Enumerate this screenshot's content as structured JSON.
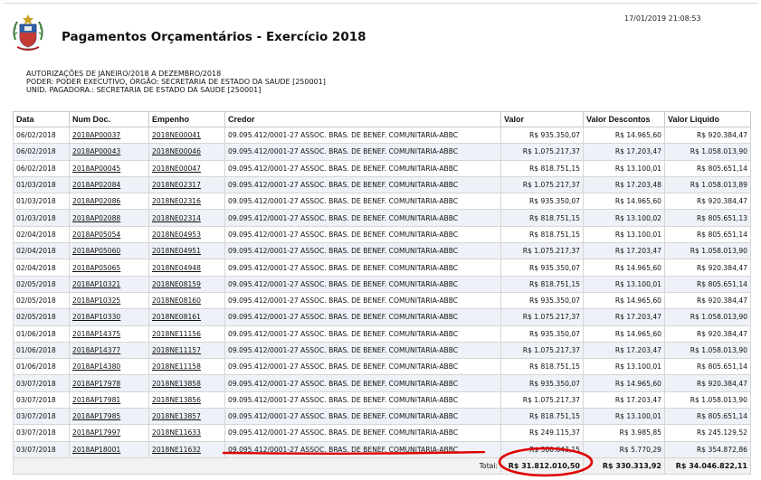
{
  "header": {
    "timestamp": "17/01/2019 21:08:53",
    "title": "Pagamentos Orçamentários - Exercício 2018",
    "crest_icon": "coat-of-arms-icon"
  },
  "info": {
    "line1": "AUTORIZAÇÕES DE JANEIRO/2018 A DEZEMBRO/2018",
    "line2": "PODER: PODER EXECUTIVO, ÓRGÃO: SECRETARIA DE ESTADO DA SAUDE [250001]",
    "line3": "UNID. PAGADORA.: SECRETARIA DE ESTADO DA SAUDE [250001]"
  },
  "table": {
    "columns": [
      "Data",
      "Num Doc.",
      "Empenho",
      "Credor",
      "Valor",
      "Valor Descontos",
      "Valor Liquido"
    ],
    "rows": [
      [
        "06/02/2018",
        "2018AP00037",
        "2018NE00041",
        "09.095.412/0001-27 ASSOC. BRAS. DE BENEF. COMUNITARIA-ABBC",
        "R$ 935.350,07",
        "R$ 14.965,60",
        "R$ 920.384,47"
      ],
      [
        "06/02/2018",
        "2018AP00043",
        "2018NE00046",
        "09.095.412/0001-27 ASSOC. BRAS. DE BENEF. COMUNITARIA-ABBC",
        "R$ 1.075.217,37",
        "R$ 17.203,47",
        "R$ 1.058.013,90"
      ],
      [
        "06/02/2018",
        "2018AP00045",
        "2018NE00047",
        "09.095.412/0001-27 ASSOC. BRAS. DE BENEF. COMUNITARIA-ABBC",
        "R$ 818.751,15",
        "R$ 13.100,01",
        "R$ 805.651,14"
      ],
      [
        "01/03/2018",
        "2018AP02084",
        "2018NE02317",
        "09.095.412/0001-27 ASSOC. BRAS. DE BENEF. COMUNITARIA-ABBC",
        "R$ 1.075.217,37",
        "R$ 17.203,48",
        "R$ 1.058.013,89"
      ],
      [
        "01/03/2018",
        "2018AP02086",
        "2018NE02316",
        "09.095.412/0001-27 ASSOC. BRAS. DE BENEF. COMUNITARIA-ABBC",
        "R$ 935.350,07",
        "R$ 14.965,60",
        "R$ 920.384,47"
      ],
      [
        "01/03/2018",
        "2018AP02088",
        "2018NE02314",
        "09.095.412/0001-27 ASSOC. BRAS. DE BENEF. COMUNITARIA-ABBC",
        "R$ 818.751,15",
        "R$ 13.100,02",
        "R$ 805.651,13"
      ],
      [
        "02/04/2018",
        "2018AP05054",
        "2018NE04953",
        "09.095.412/0001-27 ASSOC. BRAS. DE BENEF. COMUNITARIA-ABBC",
        "R$ 818.751,15",
        "R$ 13.100,01",
        "R$ 805.651,14"
      ],
      [
        "02/04/2018",
        "2018AP05060",
        "2018NE04951",
        "09.095.412/0001-27 ASSOC. BRAS. DE BENEF. COMUNITARIA-ABBC",
        "R$ 1.075.217,37",
        "R$ 17.203,47",
        "R$ 1.058.013,90"
      ],
      [
        "02/04/2018",
        "2018AP05065",
        "2018NE04948",
        "09.095.412/0001-27 ASSOC. BRAS. DE BENEF. COMUNITARIA-ABBC",
        "R$ 935.350,07",
        "R$ 14.965,60",
        "R$ 920.384,47"
      ],
      [
        "02/05/2018",
        "2018AP10321",
        "2018NE08159",
        "09.095.412/0001-27 ASSOC. BRAS. DE BENEF. COMUNITARIA-ABBC",
        "R$ 818.751,15",
        "R$ 13.100,01",
        "R$ 805.651,14"
      ],
      [
        "02/05/2018",
        "2018AP10325",
        "2018NE08160",
        "09.095.412/0001-27 ASSOC. BRAS. DE BENEF. COMUNITARIA-ABBC",
        "R$ 935.350,07",
        "R$ 14.965,60",
        "R$ 920.384,47"
      ],
      [
        "02/05/2018",
        "2018AP10330",
        "2018NE08161",
        "09.095.412/0001-27 ASSOC. BRAS. DE BENEF. COMUNITARIA-ABBC",
        "R$ 1.075.217,37",
        "R$ 17.203,47",
        "R$ 1.058.013,90"
      ],
      [
        "01/06/2018",
        "2018AP14375",
        "2018NE11156",
        "09.095.412/0001-27 ASSOC. BRAS. DE BENEF. COMUNITARIA-ABBC",
        "R$ 935.350,07",
        "R$ 14.965,60",
        "R$ 920.384,47"
      ],
      [
        "01/06/2018",
        "2018AP14377",
        "2018NE11157",
        "09.095.412/0001-27 ASSOC. BRAS. DE BENEF. COMUNITARIA-ABBC",
        "R$ 1.075.217,37",
        "R$ 17.203,47",
        "R$ 1.058.013,90"
      ],
      [
        "01/06/2018",
        "2018AP14380",
        "2018NE11158",
        "09.095.412/0001-27 ASSOC. BRAS. DE BENEF. COMUNITARIA-ABBC",
        "R$ 818.751,15",
        "R$ 13.100,01",
        "R$ 805.651,14"
      ],
      [
        "03/07/2018",
        "2018AP17978",
        "2018NE13858",
        "09.095.412/0001-27 ASSOC. BRAS. DE BENEF. COMUNITARIA-ABBC",
        "R$ 935.350,07",
        "R$ 14.965,60",
        "R$ 920.384,47"
      ],
      [
        "03/07/2018",
        "2018AP17981",
        "2018NE13856",
        "09.095.412/0001-27 ASSOC. BRAS. DE BENEF. COMUNITARIA-ABBC",
        "R$ 1.075.217,37",
        "R$ 17.203,47",
        "R$ 1.058.013,90"
      ],
      [
        "03/07/2018",
        "2018AP17985",
        "2018NE13857",
        "09.095.412/0001-27 ASSOC. BRAS. DE BENEF. COMUNITARIA-ABBC",
        "R$ 818.751,15",
        "R$ 13.100,01",
        "R$ 805.651,14"
      ],
      [
        "03/07/2018",
        "2018AP17997",
        "2018NE11633",
        "09.095.412/0001-27 ASSOC. BRAS. DE BENEF. COMUNITARIA-ABBC",
        "R$ 249.115,37",
        "R$ 3.985,85",
        "R$ 245.129,52"
      ],
      [
        "03/07/2018",
        "2018AP18001",
        "2018NE11632",
        "09.095.412/0001-27 ASSOC. BRAS. DE BENEF. COMUNITARIA-ABBC",
        "R$ 360.643,15",
        "R$ 5.770,29",
        "R$ 354.872,86"
      ]
    ],
    "total": {
      "label": "Total:",
      "valor": "R$ 31.812.010,50",
      "descontos": "R$ 330.313,92",
      "liquido": "R$ 34.046.822,11"
    }
  },
  "annotations": {
    "color": "#e00000"
  }
}
